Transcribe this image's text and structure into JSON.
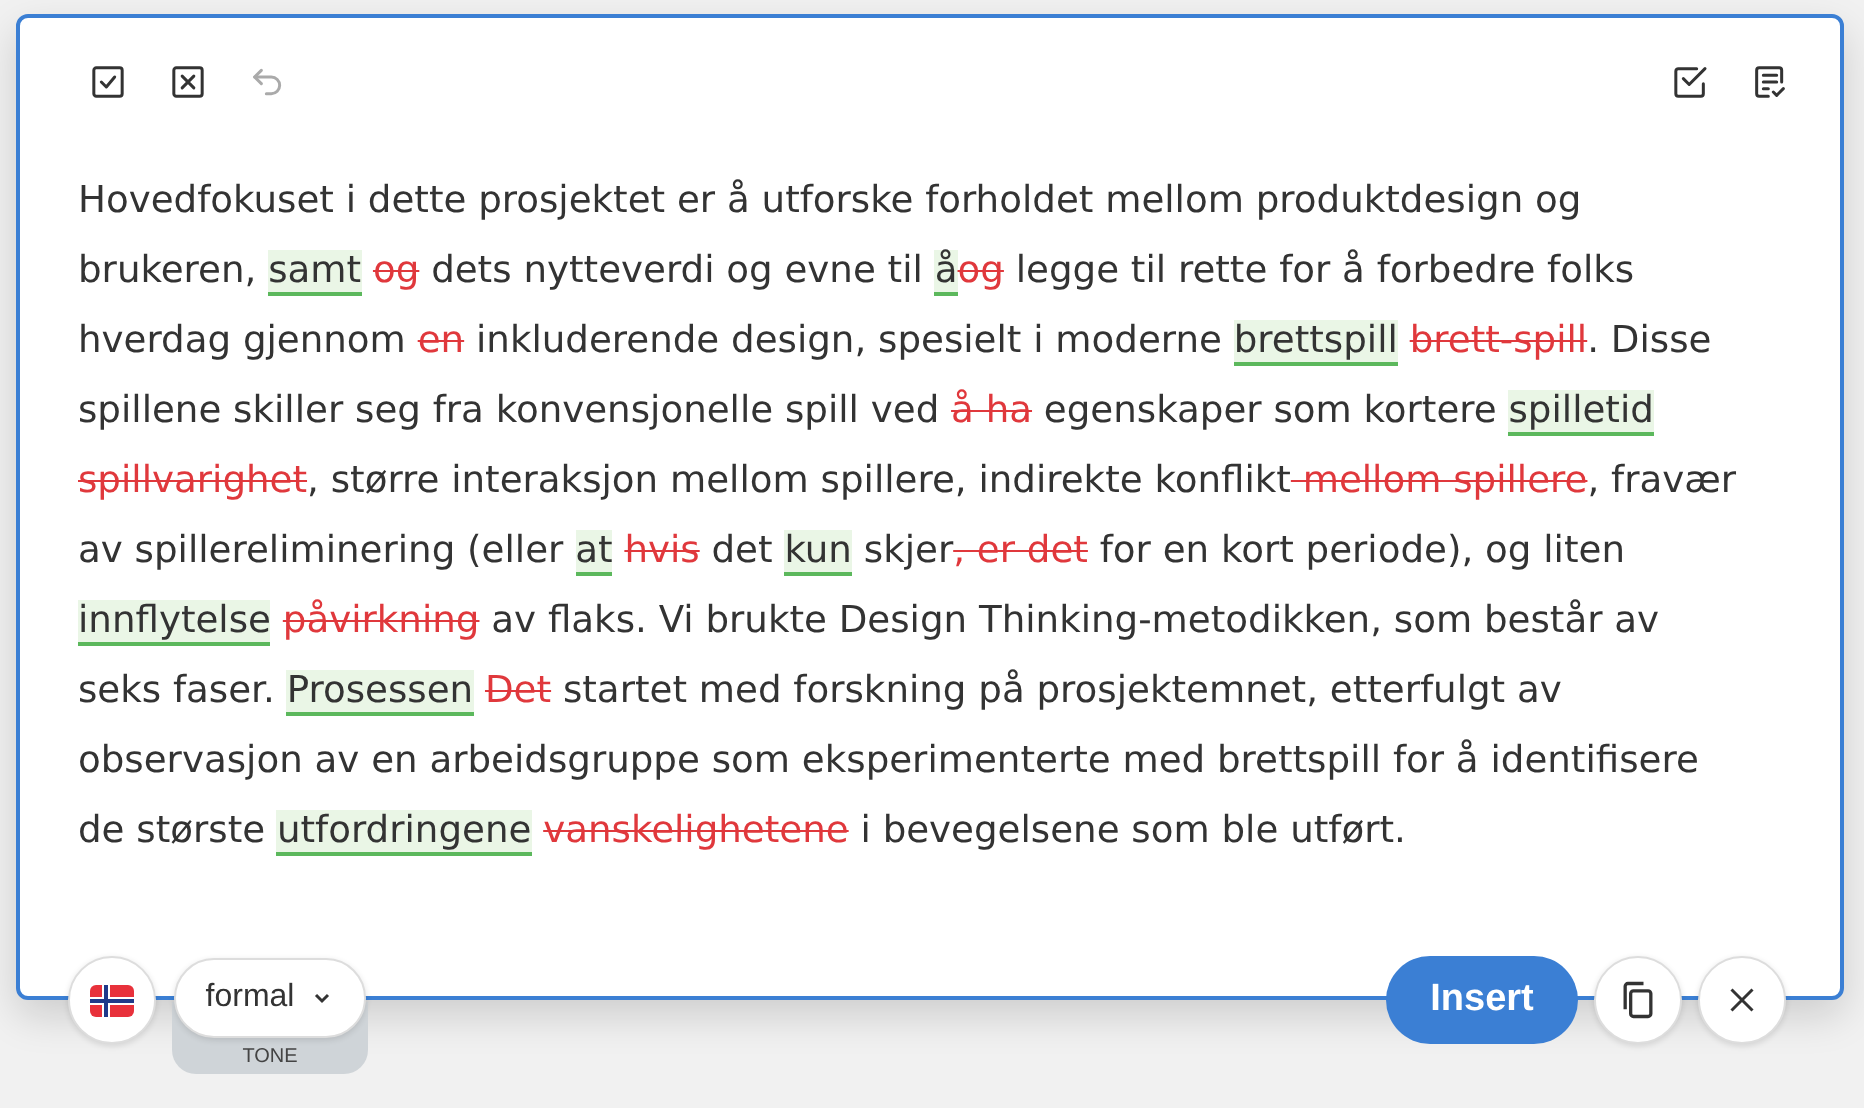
{
  "toolbar": {
    "left": [
      {
        "kind": "accept-all",
        "disabled": false
      },
      {
        "kind": "reject-all",
        "disabled": false
      },
      {
        "kind": "undo",
        "disabled": true
      }
    ],
    "right": [
      {
        "kind": "check-list",
        "disabled": false
      },
      {
        "kind": "doc-check",
        "disabled": false
      }
    ]
  },
  "suggestion": [
    {
      "kind": "plain",
      "text": "Hovedfokuset i dette prosjektet er å utforske forholdet mellom produktdesign og brukeren, "
    },
    {
      "kind": "insert",
      "text": "samt "
    },
    {
      "kind": "delete",
      "text": "og"
    },
    {
      "kind": "plain",
      "text": " dets nytteverdi og evne til "
    },
    {
      "kind": "insert",
      "text": "å"
    },
    {
      "kind": "delete",
      "text": "og"
    },
    {
      "kind": "plain",
      "text": " legge til rette for å forbedre folks hverdag gjennom "
    },
    {
      "kind": "delete",
      "text": "en"
    },
    {
      "kind": "plain",
      "text": " inkluderende design, spesielt i moderne "
    },
    {
      "kind": "insert",
      "text": "brettspill "
    },
    {
      "kind": "delete",
      "text": "brett-spill"
    },
    {
      "kind": "plain",
      "text": ". Disse spillene skiller seg fra konvensjonelle spill ved "
    },
    {
      "kind": "delete",
      "text": "å ha"
    },
    {
      "kind": "plain",
      "text": " egenskaper som kortere "
    },
    {
      "kind": "insert",
      "text": "spilletid"
    },
    {
      "kind": "delete",
      "text": " spillvarighet"
    },
    {
      "kind": "plain",
      "text": ", større interaksjon mellom spillere, indirekte konflikt"
    },
    {
      "kind": "delete",
      "text": " mellom spillere"
    },
    {
      "kind": "plain",
      "text": ", fravær av spillereliminering (eller "
    },
    {
      "kind": "insert",
      "text": "at "
    },
    {
      "kind": "delete",
      "text": "hvis"
    },
    {
      "kind": "plain",
      "text": " det "
    },
    {
      "kind": "insert",
      "text": "kun"
    },
    {
      "kind": "plain",
      "text": " skjer"
    },
    {
      "kind": "delete",
      "text": ", er det"
    },
    {
      "kind": "plain",
      "text": " for en kort periode), og liten "
    },
    {
      "kind": "insert",
      "text": "innflytelse "
    },
    {
      "kind": "delete",
      "text": "påvirkning"
    },
    {
      "kind": "plain",
      "text": " av flaks. Vi brukte Design Thinking-metodikken, som består av seks faser. "
    },
    {
      "kind": "insert",
      "text": "Prosessen "
    },
    {
      "kind": "delete",
      "text": "Det"
    },
    {
      "kind": "plain",
      "text": " startet med forskning på prosjektemnet, etterfulgt av observasjon av en arbeidsgruppe som eksperimenterte med brettspill for å identifisere de største "
    },
    {
      "kind": "insert",
      "text": "utfordringene "
    },
    {
      "kind": "delete",
      "text": "vanskelighetene"
    },
    {
      "kind": "plain",
      "text": " i bevegelsene som ble utført."
    }
  ],
  "language": {
    "kind": "norway"
  },
  "tone": {
    "value": "formal",
    "label": "TONE"
  },
  "actions": {
    "insert": "Insert"
  }
}
